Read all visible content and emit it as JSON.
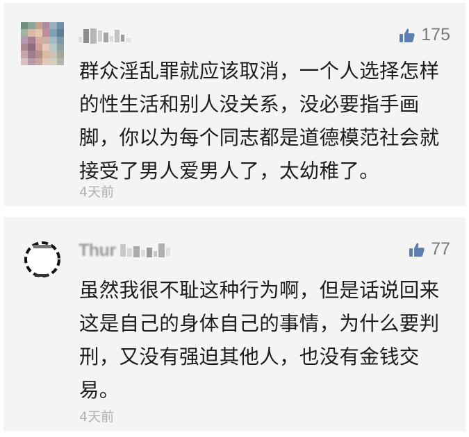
{
  "comments": [
    {
      "username": "",
      "likes": "175",
      "text": "群众淫乱罪就应该取消，一个人选择怎样的性生活和别人没关系，没必要指手画脚，你以为每个同志都是道德模范社会就接受了男人爱男人了，太幼稚了。",
      "time": "4天前"
    },
    {
      "username": "Thur",
      "likes": "77",
      "text": "虽然我很不耻这种行为啊，但是话说回来这是自己的身体自己的事情，为什么要判刑，又没有强迫其他人，也没有金钱交易。",
      "time": "4天前"
    }
  ],
  "colors": {
    "card_bg": "#f4f4f4",
    "like_icon": "#5b7fb0",
    "text": "#1d1d1d",
    "meta": "#b1b1b1"
  },
  "icons": {
    "like": "thumbs-up-icon"
  }
}
